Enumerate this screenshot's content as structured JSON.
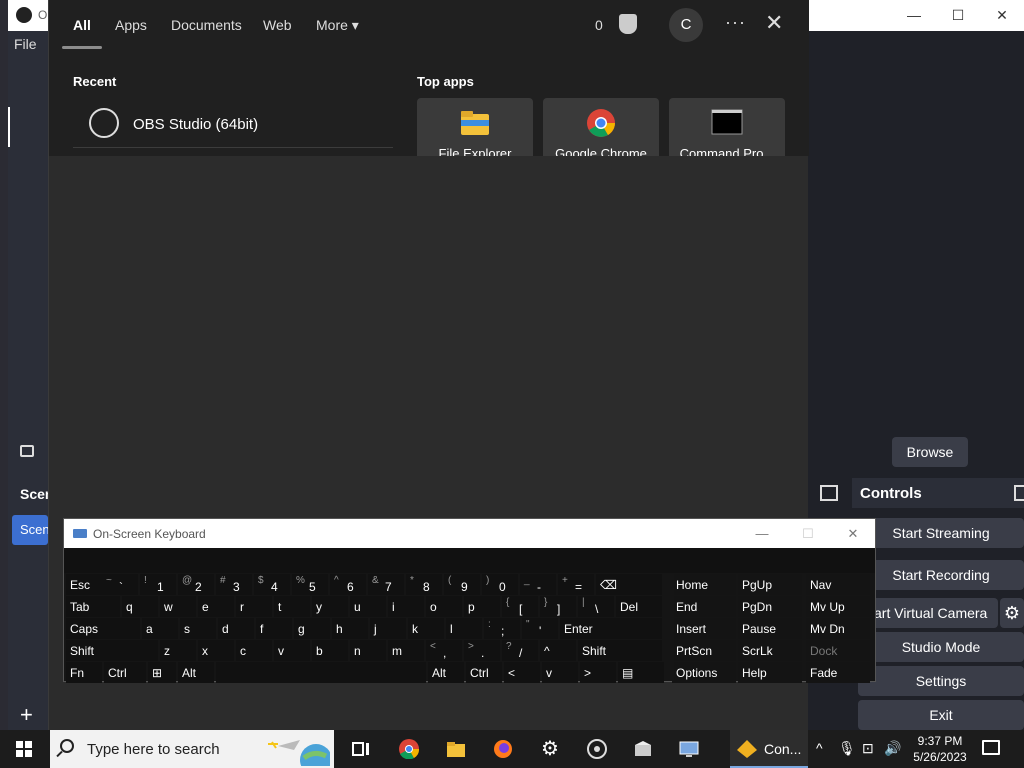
{
  "obs": {
    "title_text": "O",
    "menu_file": "File",
    "scenes_header": "Scen",
    "scene_item": "Scen",
    "add_label": "+",
    "browse_label": "Browse",
    "controls_title": "Controls",
    "buttons": [
      "Start Streaming",
      "Start Recording",
      "art Virtual Camera",
      "Studio Mode",
      "Settings",
      "Exit"
    ],
    "window_controls": [
      "—",
      "☐",
      "✕"
    ]
  },
  "search": {
    "tabs": [
      "All",
      "Apps",
      "Documents",
      "Web",
      "More"
    ],
    "more_caret": "▾",
    "reward_points": "0",
    "user_initial": "C",
    "more_menu": "···",
    "close_glyph": "✕",
    "recent_heading": "Recent",
    "recent_item": "OBS Studio (64bit)",
    "top_apps_heading": "Top apps",
    "top_apps": [
      "File Explorer",
      "Google Chrome",
      "Command Pro..."
    ]
  },
  "osk": {
    "title": "On-Screen Keyboard",
    "window_controls": [
      "—",
      "☐",
      "✕"
    ],
    "row1": [
      {
        "main": "Esc"
      },
      {
        "sup": "~",
        "low": "`"
      },
      {
        "sup": "!",
        "low": "1"
      },
      {
        "sup": "@",
        "low": "2"
      },
      {
        "sup": "#",
        "low": "3"
      },
      {
        "sup": "$",
        "low": "4"
      },
      {
        "sup": "%",
        "low": "5"
      },
      {
        "sup": "^",
        "low": "6"
      },
      {
        "sup": "&",
        "low": "7"
      },
      {
        "sup": "*",
        "low": "8"
      },
      {
        "sup": "(",
        "low": "9"
      },
      {
        "sup": ")",
        "low": "0"
      },
      {
        "sup": "_",
        "low": "-"
      },
      {
        "sup": "+",
        "low": "="
      },
      {
        "main": "⌫"
      }
    ],
    "row2": [
      "Tab",
      "q",
      "w",
      "e",
      "r",
      "t",
      "y",
      "u",
      "i",
      "o",
      "p",
      "[",
      "]",
      "\\",
      "Del"
    ],
    "row2_sup": [
      "",
      "",
      "",
      "",
      "",
      "",
      "",
      "",
      "",
      "",
      "",
      "{",
      "}",
      "|",
      ""
    ],
    "row3": [
      "Caps",
      "a",
      "s",
      "d",
      "f",
      "g",
      "h",
      "j",
      "k",
      "l",
      ";",
      "'",
      "Enter"
    ],
    "row3_sup": [
      "",
      "",
      "",
      "",
      "",
      "",
      "",
      "",
      "",
      "",
      ":",
      "\"",
      ""
    ],
    "row4": [
      "Shift",
      "z",
      "x",
      "c",
      "v",
      "b",
      "n",
      "m",
      ",",
      ".",
      "/",
      "^",
      "Shift"
    ],
    "row4_sup": [
      "",
      "",
      "",
      "",
      "",
      "",
      "",
      "",
      "<",
      ">",
      "?",
      "",
      ""
    ],
    "row5": [
      "Fn",
      "Ctrl",
      "⊞",
      "Alt",
      "",
      "Alt",
      "Ctrl",
      "<",
      "v",
      ">",
      "▤"
    ],
    "nav": [
      [
        "Home",
        "PgUp",
        "Nav"
      ],
      [
        "End",
        "PgDn",
        "Mv Up"
      ],
      [
        "Insert",
        "Pause",
        "Mv Dn"
      ],
      [
        "PrtScn",
        "ScrLk",
        "Dock"
      ],
      [
        "Options",
        "Help",
        "Fade"
      ]
    ]
  },
  "taskbar": {
    "search_placeholder": "Type here to search",
    "console_label": "Con...",
    "tray_chevron": "^",
    "tray_mic": "🎙",
    "tray_network": "⊡",
    "tray_volume": "🔊",
    "time": "9:37 PM",
    "date": "5/26/2023"
  },
  "colors": {
    "accent": "#3c6fd1",
    "panel": "#2c2c2c",
    "obs_bg": "#1f2128"
  }
}
